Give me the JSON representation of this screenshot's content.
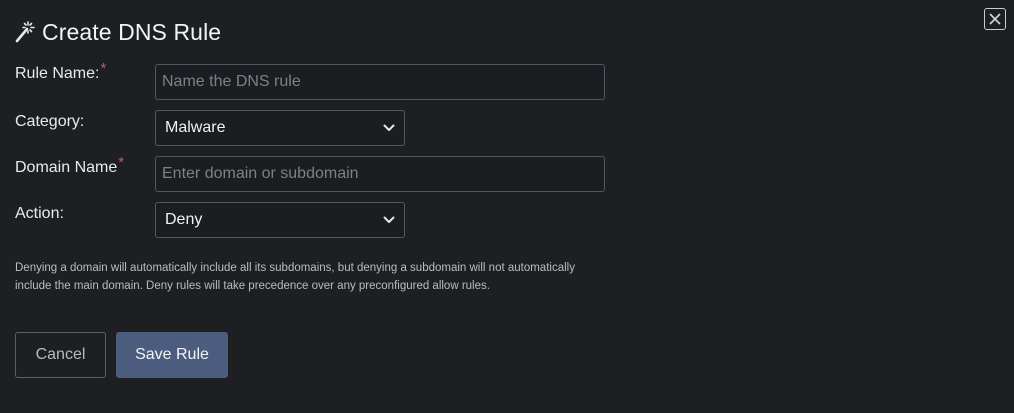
{
  "dialog": {
    "title": "Create DNS Rule",
    "title_icon": "magic-wand-icon",
    "close_icon": "close-icon"
  },
  "form": {
    "rule_name": {
      "label": "Rule Name:",
      "required_mark": "*",
      "value": "",
      "placeholder": "Name the DNS rule"
    },
    "category": {
      "label": "Category:",
      "selected": "Malware"
    },
    "domain_name": {
      "label": "Domain Name",
      "required_mark": "*",
      "value": "",
      "placeholder": "Enter domain or subdomain"
    },
    "action": {
      "label": "Action:",
      "selected": "Deny"
    }
  },
  "help_text": "Denying a domain will automatically include all its subdomains, but denying a subdomain will not automatically include the main domain. Deny rules will take precedence over any preconfigured allow rules.",
  "buttons": {
    "cancel_label": "Cancel",
    "save_label": "Save Rule"
  },
  "colors": {
    "background": "#1d1f22",
    "required": "#d9534f",
    "primary_button": "#4b5c7f",
    "input_border": "#4f5863"
  }
}
